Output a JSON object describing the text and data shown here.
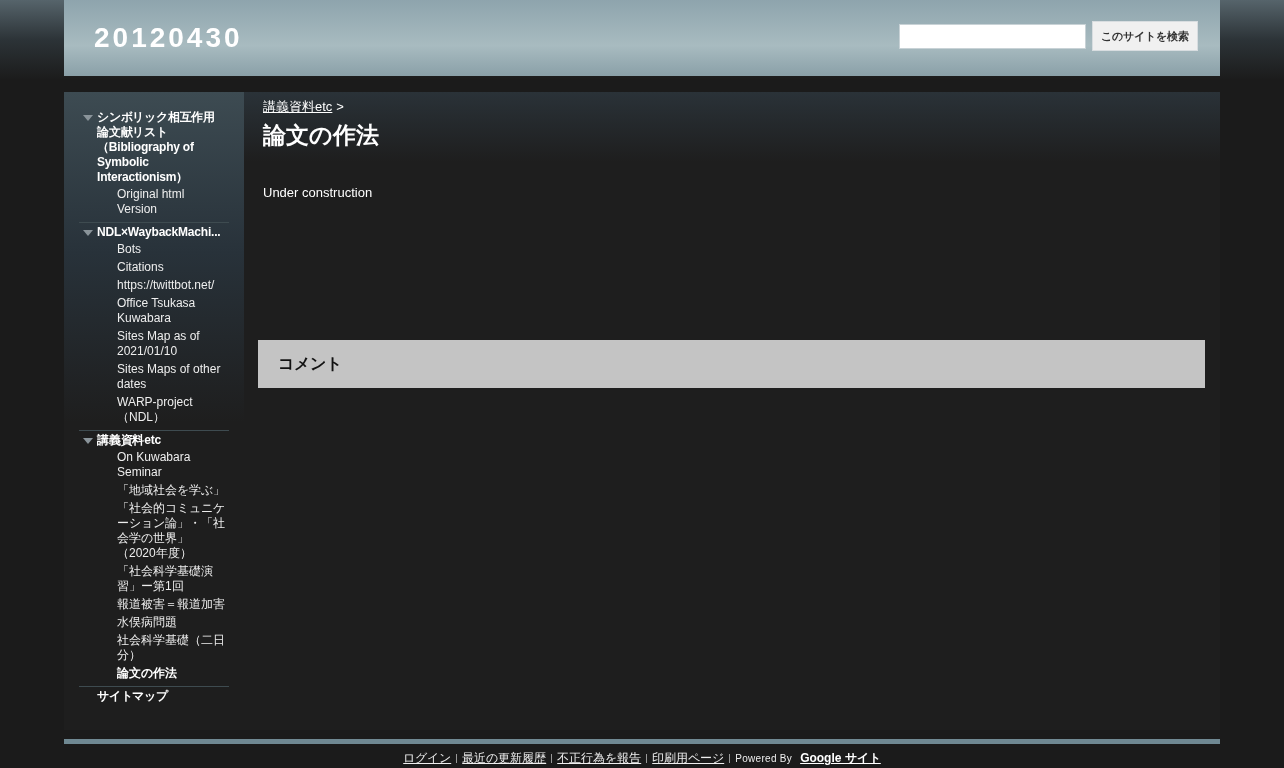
{
  "site_title": "20120430",
  "search": {
    "button": "このサイトを検索"
  },
  "sidebar": {
    "items": [
      {
        "kind": "group",
        "label": "シンボリック相互作用論文献リスト（Bibliography of Symbolic Interactionism）",
        "expanded": true,
        "selected": false,
        "children": [
          {
            "label": "Original html Version",
            "selected": false
          }
        ]
      },
      {
        "kind": "group",
        "label": "NDL×WaybackMachi...",
        "expanded": true,
        "selected": false,
        "children": [
          {
            "label": "Bots",
            "selected": false
          },
          {
            "label": "Citations",
            "selected": false
          },
          {
            "label": "https://twittbot.net/",
            "selected": false
          },
          {
            "label": "Office Tsukasa Kuwabara",
            "selected": false
          },
          {
            "label": "Sites Map as of 2021/01/10",
            "selected": false
          },
          {
            "label": "Sites Maps of other dates",
            "selected": false
          },
          {
            "label": "WARP-project（NDL）",
            "selected": false
          }
        ]
      },
      {
        "kind": "group",
        "label": "講義資料etc",
        "expanded": true,
        "selected": false,
        "children": [
          {
            "label": "On Kuwabara Seminar",
            "selected": false
          },
          {
            "label": "「地域社会を学ぶ」",
            "selected": false
          },
          {
            "label": "「社会的コミュニケーション論」・「社会学の世界」（2020年度）",
            "selected": false
          },
          {
            "label": "「社会科学基礎演習」ー第1回",
            "selected": false
          },
          {
            "label": "報道被害＝報道加害",
            "selected": false
          },
          {
            "label": "水俣病問題",
            "selected": false
          },
          {
            "label": "社会科学基礎（二日分）",
            "selected": false
          },
          {
            "label": "論文の作法",
            "selected": true
          }
        ]
      },
      {
        "kind": "link",
        "label": "サイトマップ",
        "selected": false
      }
    ]
  },
  "breadcrumb": {
    "link": "講義資料etc",
    "separator": ">"
  },
  "page_title": "論文の作法",
  "body_text": "Under construction",
  "comments_heading": "コメント",
  "footer": {
    "links": [
      "ログイン",
      "最近の更新履歴",
      "不正行為を報告",
      "印刷用ページ"
    ],
    "powered_by": "Powered By",
    "brand_link": "Google サイト"
  }
}
